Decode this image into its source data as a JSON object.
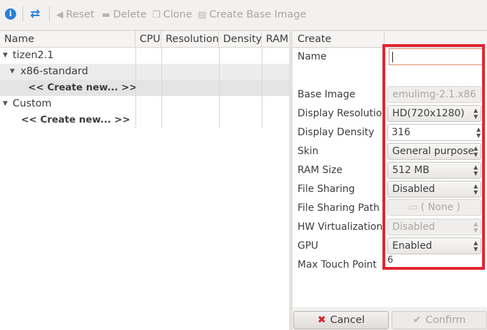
{
  "toolbar": {
    "reset_label": "Reset",
    "delete_label": "Delete",
    "clone_label": "Clone",
    "create_base_label": "Create Base Image"
  },
  "tree": {
    "columns": [
      "Name",
      "CPU",
      "Resolution",
      "Density",
      "RAM"
    ],
    "rows": [
      {
        "label": "tizen2.1"
      },
      {
        "label": "x86-standard"
      },
      {
        "label": "<< Create new... >>"
      },
      {
        "label": "Custom"
      },
      {
        "label": "<< Create new... >>"
      }
    ]
  },
  "panel": {
    "header": "Create",
    "fields": {
      "name_label": "Name",
      "name_value": "",
      "base_image_label": "Base Image",
      "base_image_value": "emulimg-2.1.x86",
      "display_resolution_label": "Display Resolution",
      "display_resolution_value": "HD(720x1280)",
      "display_density_label": "Display Density",
      "display_density_value": "316",
      "skin_label": "Skin",
      "skin_value": "General purpose",
      "ram_size_label": "RAM Size",
      "ram_size_value": "512 MB",
      "file_sharing_label": "File Sharing",
      "file_sharing_value": "Disabled",
      "file_sharing_path_label": "File Sharing Path",
      "file_sharing_path_value": "( None )",
      "hw_virtualization_label": "HW Virtualization",
      "hw_virtualization_value": "Disabled",
      "gpu_label": "GPU",
      "gpu_value": "Enabled",
      "max_touch_label": "Max Touch Point",
      "max_touch_value": "6"
    }
  },
  "buttons": {
    "cancel_label": "Cancel",
    "confirm_label": "Confirm"
  },
  "colors": {
    "highlight_border": "#e3232f",
    "accent": "#2a7fd4"
  }
}
